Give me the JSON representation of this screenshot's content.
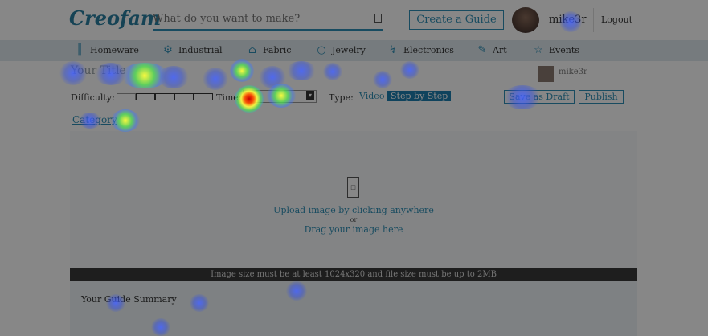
{
  "header": {
    "logo": "Creofam",
    "search_placeholder": "What do you want to make?",
    "create_guide": "Create a Guide",
    "username": "mike3r",
    "logout": "Logout"
  },
  "categories": [
    {
      "label": "Homeware",
      "icon": "chair-icon"
    },
    {
      "label": "Industrial",
      "icon": "gear-icon"
    },
    {
      "label": "Fabric",
      "icon": "shirt-icon"
    },
    {
      "label": "Jewelry",
      "icon": "ring-icon"
    },
    {
      "label": "Electronics",
      "icon": "lightning-icon"
    },
    {
      "label": "Art",
      "icon": "pencil-icon"
    },
    {
      "label": "Events",
      "icon": "star-icon"
    }
  ],
  "editor": {
    "title_placeholder": "Your Title",
    "difficulty_label": "Difficulty:",
    "time_label": "Time:",
    "type_label": "Type:",
    "type_options": [
      "Video",
      "Step by Step"
    ],
    "type_selected": "Step by Step",
    "save_draft": "Save as Draft",
    "publish": "Publish",
    "category_link": "Category",
    "upload_line1": "Upload image by clicking anywhere",
    "upload_or": "or",
    "upload_line2": "Drag your image here",
    "size_notice": "Image size must be at least 1024x320 and file size must be up to 2MB",
    "summary_placeholder": "Your Guide Summary"
  },
  "colors": {
    "accent": "#2f8fb5",
    "nav_background": "#dfe8ee",
    "notice_bar": "#3a3a3a"
  }
}
